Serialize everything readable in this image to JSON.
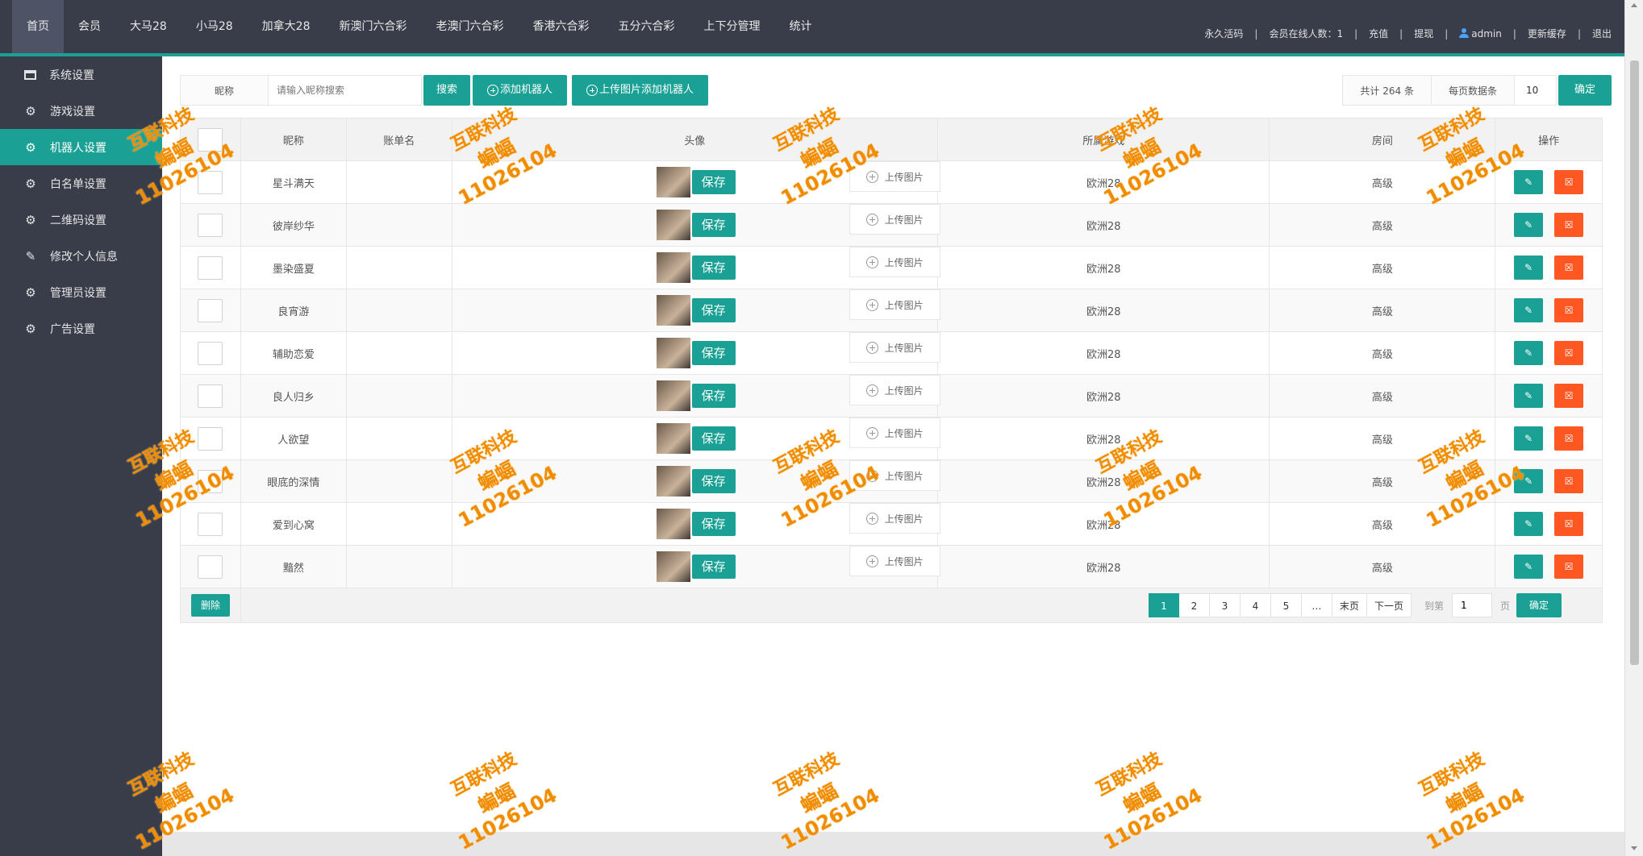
{
  "nav": {
    "items": [
      "首页",
      "会员",
      "大马28",
      "小马28",
      "加拿大28",
      "新澳门六合彩",
      "老澳门六合彩",
      "香港六合彩",
      "五分六合彩",
      "上下分管理",
      "统计"
    ],
    "active_index": 0,
    "right": {
      "activation": "永久活码",
      "online": "会员在线人数：1",
      "recharge": "充值",
      "withdraw": "提现",
      "user": "admin",
      "refresh_cache": "更新缓存",
      "logout": "退出"
    }
  },
  "sidebar": {
    "items": [
      {
        "label": "系统设置",
        "icon": "window-icon"
      },
      {
        "label": "游戏设置",
        "icon": "gear-icon"
      },
      {
        "label": "机器人设置",
        "icon": "gear-icon"
      },
      {
        "label": "白名单设置",
        "icon": "gear-icon"
      },
      {
        "label": "二维码设置",
        "icon": "gear-icon"
      },
      {
        "label": "修改个人信息",
        "icon": "pencil-icon"
      },
      {
        "label": "管理员设置",
        "icon": "gear-icon"
      },
      {
        "label": "广告设置",
        "icon": "gear-icon"
      }
    ],
    "active_index": 2
  },
  "toolbar": {
    "nick_label": "昵称",
    "search_placeholder": "请输入昵称搜索",
    "search_button": "搜索",
    "add_robot_button": "添加机器人",
    "upload_add_button": "上传图片添加机器人",
    "total": "共计 264 条",
    "per_page_label": "每页数据条",
    "per_page_value": "10",
    "confirm": "确定"
  },
  "table": {
    "headers": {
      "nick": "昵称",
      "account": "账单名",
      "avatar": "头像",
      "game": "所属游戏",
      "room": "房间",
      "ops": "操作"
    },
    "save_label": "保存",
    "upload_label": "上传图片",
    "rows": [
      {
        "nick": "星斗满天",
        "account": "",
        "game": "欧洲28",
        "room": "高级"
      },
      {
        "nick": "彼岸纱华",
        "account": "",
        "game": "欧洲28",
        "room": "高级"
      },
      {
        "nick": "墨染盛夏",
        "account": "",
        "game": "欧洲28",
        "room": "高级"
      },
      {
        "nick": "良宵游",
        "account": "",
        "game": "欧洲28",
        "room": "高级"
      },
      {
        "nick": "辅助恋爱",
        "account": "",
        "game": "欧洲28",
        "room": "高级"
      },
      {
        "nick": "良人归乡",
        "account": "",
        "game": "欧洲28",
        "room": "高级"
      },
      {
        "nick": "人欲望",
        "account": "",
        "game": "欧洲28",
        "room": "高级"
      },
      {
        "nick": "眼底的深情",
        "account": "",
        "game": "欧洲28",
        "room": "高级"
      },
      {
        "nick": "爱到心窝",
        "account": "",
        "game": "欧洲28",
        "room": "高级"
      },
      {
        "nick": "黯然",
        "account": "",
        "game": "欧洲28",
        "room": "高级"
      }
    ],
    "delete_button": "删除"
  },
  "pager": {
    "pages": [
      "1",
      "2",
      "3",
      "4",
      "5",
      "…",
      "末页",
      "下一页"
    ],
    "current": "1",
    "goto_label": "到第",
    "goto_value": "1",
    "unit": "页",
    "confirm": "确定"
  },
  "watermark": {
    "line1": "互联科技",
    "line2": "蝙蝠11026104"
  },
  "colors": {
    "nav_bg": "#393d49",
    "accent": "#1aa094",
    "danger": "#ff5722",
    "watermark": "#f08c00"
  }
}
